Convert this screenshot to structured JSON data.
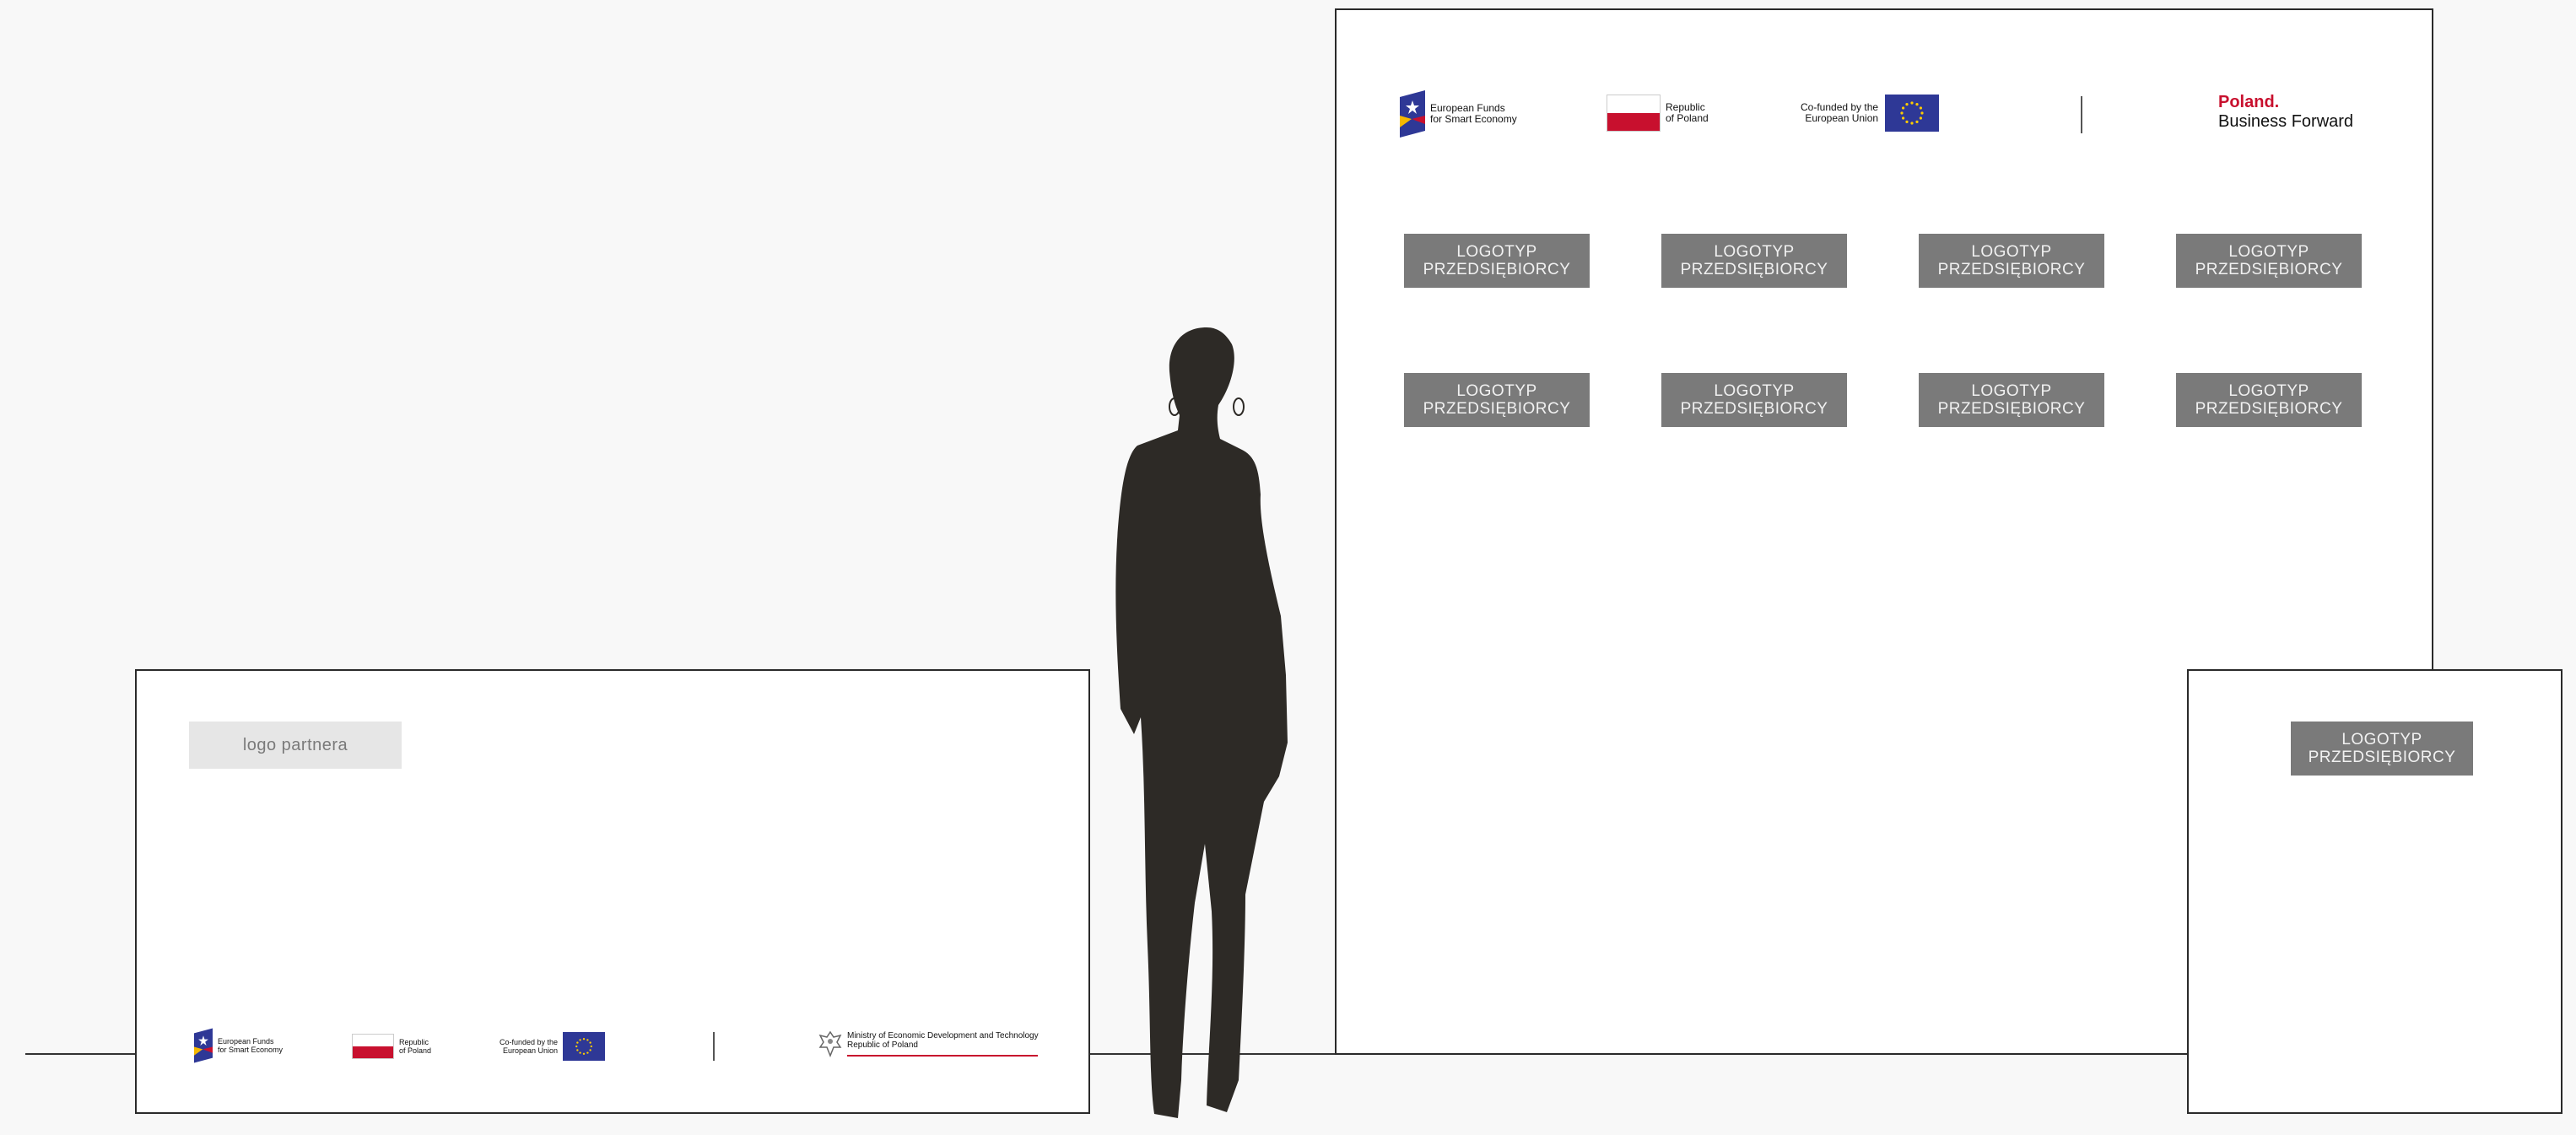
{
  "funds_logo": {
    "line1": "European Funds",
    "line2": "for Smart Economy"
  },
  "poland_logo": {
    "line1": "Republic",
    "line2": "of Poland"
  },
  "eu_logo": {
    "line1": "Co-funded by the",
    "line2": "European Union"
  },
  "brand": {
    "line1": "Poland.",
    "line2": "Business Forward"
  },
  "ministry": {
    "line1": "Ministry of Economic Development and Technology",
    "line2": "Republic of Poland"
  },
  "logo_placeholder": {
    "line1": "LOGOTYP",
    "line2": "PRZEDSIĘBIORCY"
  },
  "partner_logo": "logo partnera",
  "colors": {
    "flag_red": "#c8102e",
    "eu_blue": "#2e3896",
    "placeholder_grey": "#7a7a7a",
    "silhouette": "#2d2a26"
  }
}
